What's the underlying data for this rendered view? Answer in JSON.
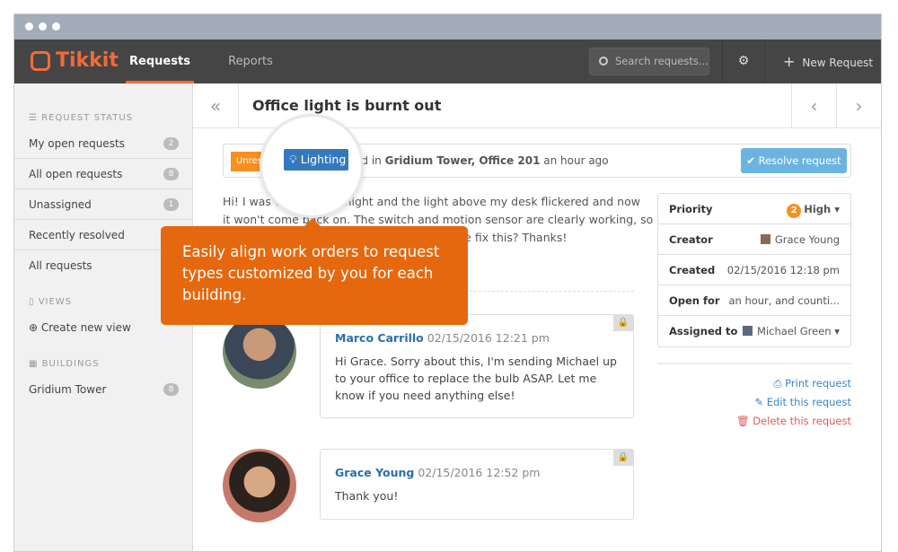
{
  "window": {
    "dots": 3
  },
  "nav": {
    "logo": "Tikkit",
    "tabs": [
      {
        "label": "Requests",
        "active": true
      },
      {
        "label": "Reports",
        "active": false
      }
    ],
    "search_placeholder": "Search requests...",
    "new_request": "New Request",
    "accent": "#f26b3a"
  },
  "sidebar": {
    "status_heading": "REQUEST STATUS",
    "items": [
      {
        "label": "My open requests",
        "count": "2"
      },
      {
        "label": "All open requests",
        "count": "8"
      },
      {
        "label": "Unassigned",
        "count": "1"
      },
      {
        "label": "Recently resolved"
      },
      {
        "label": "All requests"
      }
    ],
    "views_heading": "VIEWS",
    "create_view": "Create new view",
    "buildings_heading": "BUILDINGS",
    "buildings": [
      {
        "label": "Gridium Tower",
        "count": "8"
      }
    ]
  },
  "request": {
    "title": "Office light is burnt out",
    "status": "Unresolved",
    "status_visible": "Unreso",
    "category": "Lighting",
    "location_prefix": "ed in",
    "location": "Gridium Tower, Office 201",
    "time": "an hour ago",
    "resolve": "Resolve request",
    "body_lines": [
      "Hi! I was wo",
      "tonight and the light above my desk flickered and now",
      "it won't come back on. The switch and motion sensor are clearly working, so",
      "me fix this? Thanks!"
    ],
    "comments": [
      {
        "author": "Marco Carrillo",
        "date": "02/15/2016 12:21 pm",
        "text": "Hi Grace. Sorry about this, I'm sending Michael up to your office to replace the bulb ASAP. Let me know if you need anything else!"
      },
      {
        "author": "Grace Young",
        "date": "02/15/2016 12:52 pm",
        "text": "Thank you!"
      }
    ],
    "details": [
      {
        "key": "Priority",
        "value": "High",
        "num": "2"
      },
      {
        "key": "Creator",
        "value": "Grace Young"
      },
      {
        "key": "Created",
        "value": "02/15/2016 12:18 pm"
      },
      {
        "key": "Open for",
        "value": "an hour, and counti..."
      },
      {
        "key": "Assigned to",
        "value": "Michael Green"
      }
    ],
    "actions": {
      "print": "Print request",
      "edit": "Edit this request",
      "delete": "Delete this request"
    }
  },
  "tooltip": "Easily align work orders to request types customized by you for each building."
}
